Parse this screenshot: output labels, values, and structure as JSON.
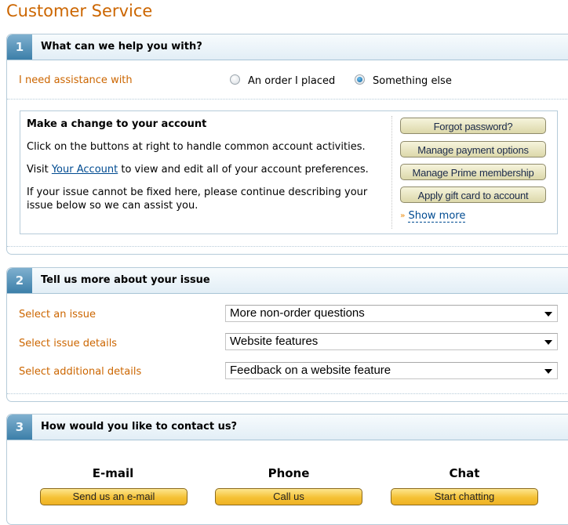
{
  "page": {
    "title": "Customer Service"
  },
  "colors": {
    "accent_orange": "#cc6600",
    "link_blue": "#004b91",
    "section_blue": "#3c7fa9",
    "gold_button": "#f5c135"
  },
  "step1": {
    "number": "1",
    "heading": "What can we help you with?",
    "assist_label": "I need assistance with",
    "options": [
      {
        "label": "An order I placed",
        "checked": false
      },
      {
        "label": "Something else",
        "checked": true
      }
    ],
    "account_box": {
      "title": "Make a change to your account",
      "line1": "Click on the buttons at right to handle common account activities.",
      "line2_prefix": "Visit ",
      "line2_link": "Your Account",
      "line2_suffix": " to view and edit all of your account preferences.",
      "line3": "If your issue cannot be fixed here, please continue describing your issue below so we can assist you.",
      "buttons": [
        "Forgot password?",
        "Manage payment options",
        "Manage Prime membership",
        "Apply gift card to account"
      ],
      "show_more": "Show more",
      "show_more_icon": "double-chevron-down-icon"
    }
  },
  "step2": {
    "number": "2",
    "heading": "Tell us more about your issue",
    "fields": [
      {
        "label": "Select an issue",
        "value": "More non-order questions"
      },
      {
        "label": "Select issue details",
        "value": "Website features"
      },
      {
        "label": "Select additional details",
        "value": "Feedback on a website feature"
      }
    ]
  },
  "step3": {
    "number": "3",
    "heading": "How would you like to contact us?",
    "methods": [
      {
        "title": "E-mail",
        "button": "Send us an e-mail"
      },
      {
        "title": "Phone",
        "button": "Call us"
      },
      {
        "title": "Chat",
        "button": "Start chatting"
      }
    ]
  }
}
